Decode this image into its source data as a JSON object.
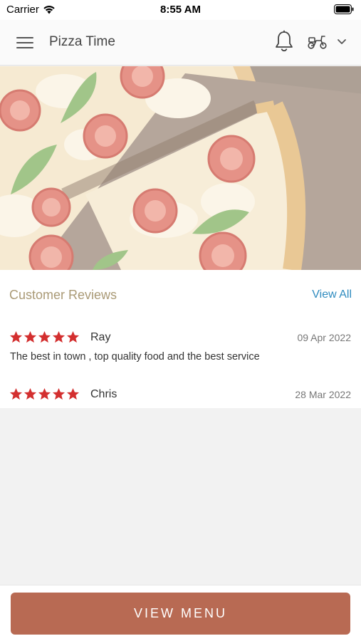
{
  "status_bar": {
    "carrier": "Carrier",
    "time": "8:55 AM"
  },
  "nav": {
    "title": "Pizza Time",
    "icons": [
      "hamburger-menu-icon",
      "bell-icon",
      "scooter-icon",
      "chevron-down-icon"
    ]
  },
  "reviews": {
    "title": "Customer Reviews",
    "view_all": "View All",
    "items": [
      {
        "name": "Ray",
        "date": "09 Apr 2022",
        "rating": 5,
        "text": "The best in town , top quality food and the best service"
      },
      {
        "name": "Chris",
        "date": "28 Mar 2022",
        "rating": 5,
        "text": ""
      }
    ]
  },
  "footer": {
    "button_label": "VIEW MENU"
  },
  "colors": {
    "accent": "#b86a53",
    "link": "#2e8bbf",
    "section_title": "#aa9a76",
    "star": "#d32f2f"
  }
}
